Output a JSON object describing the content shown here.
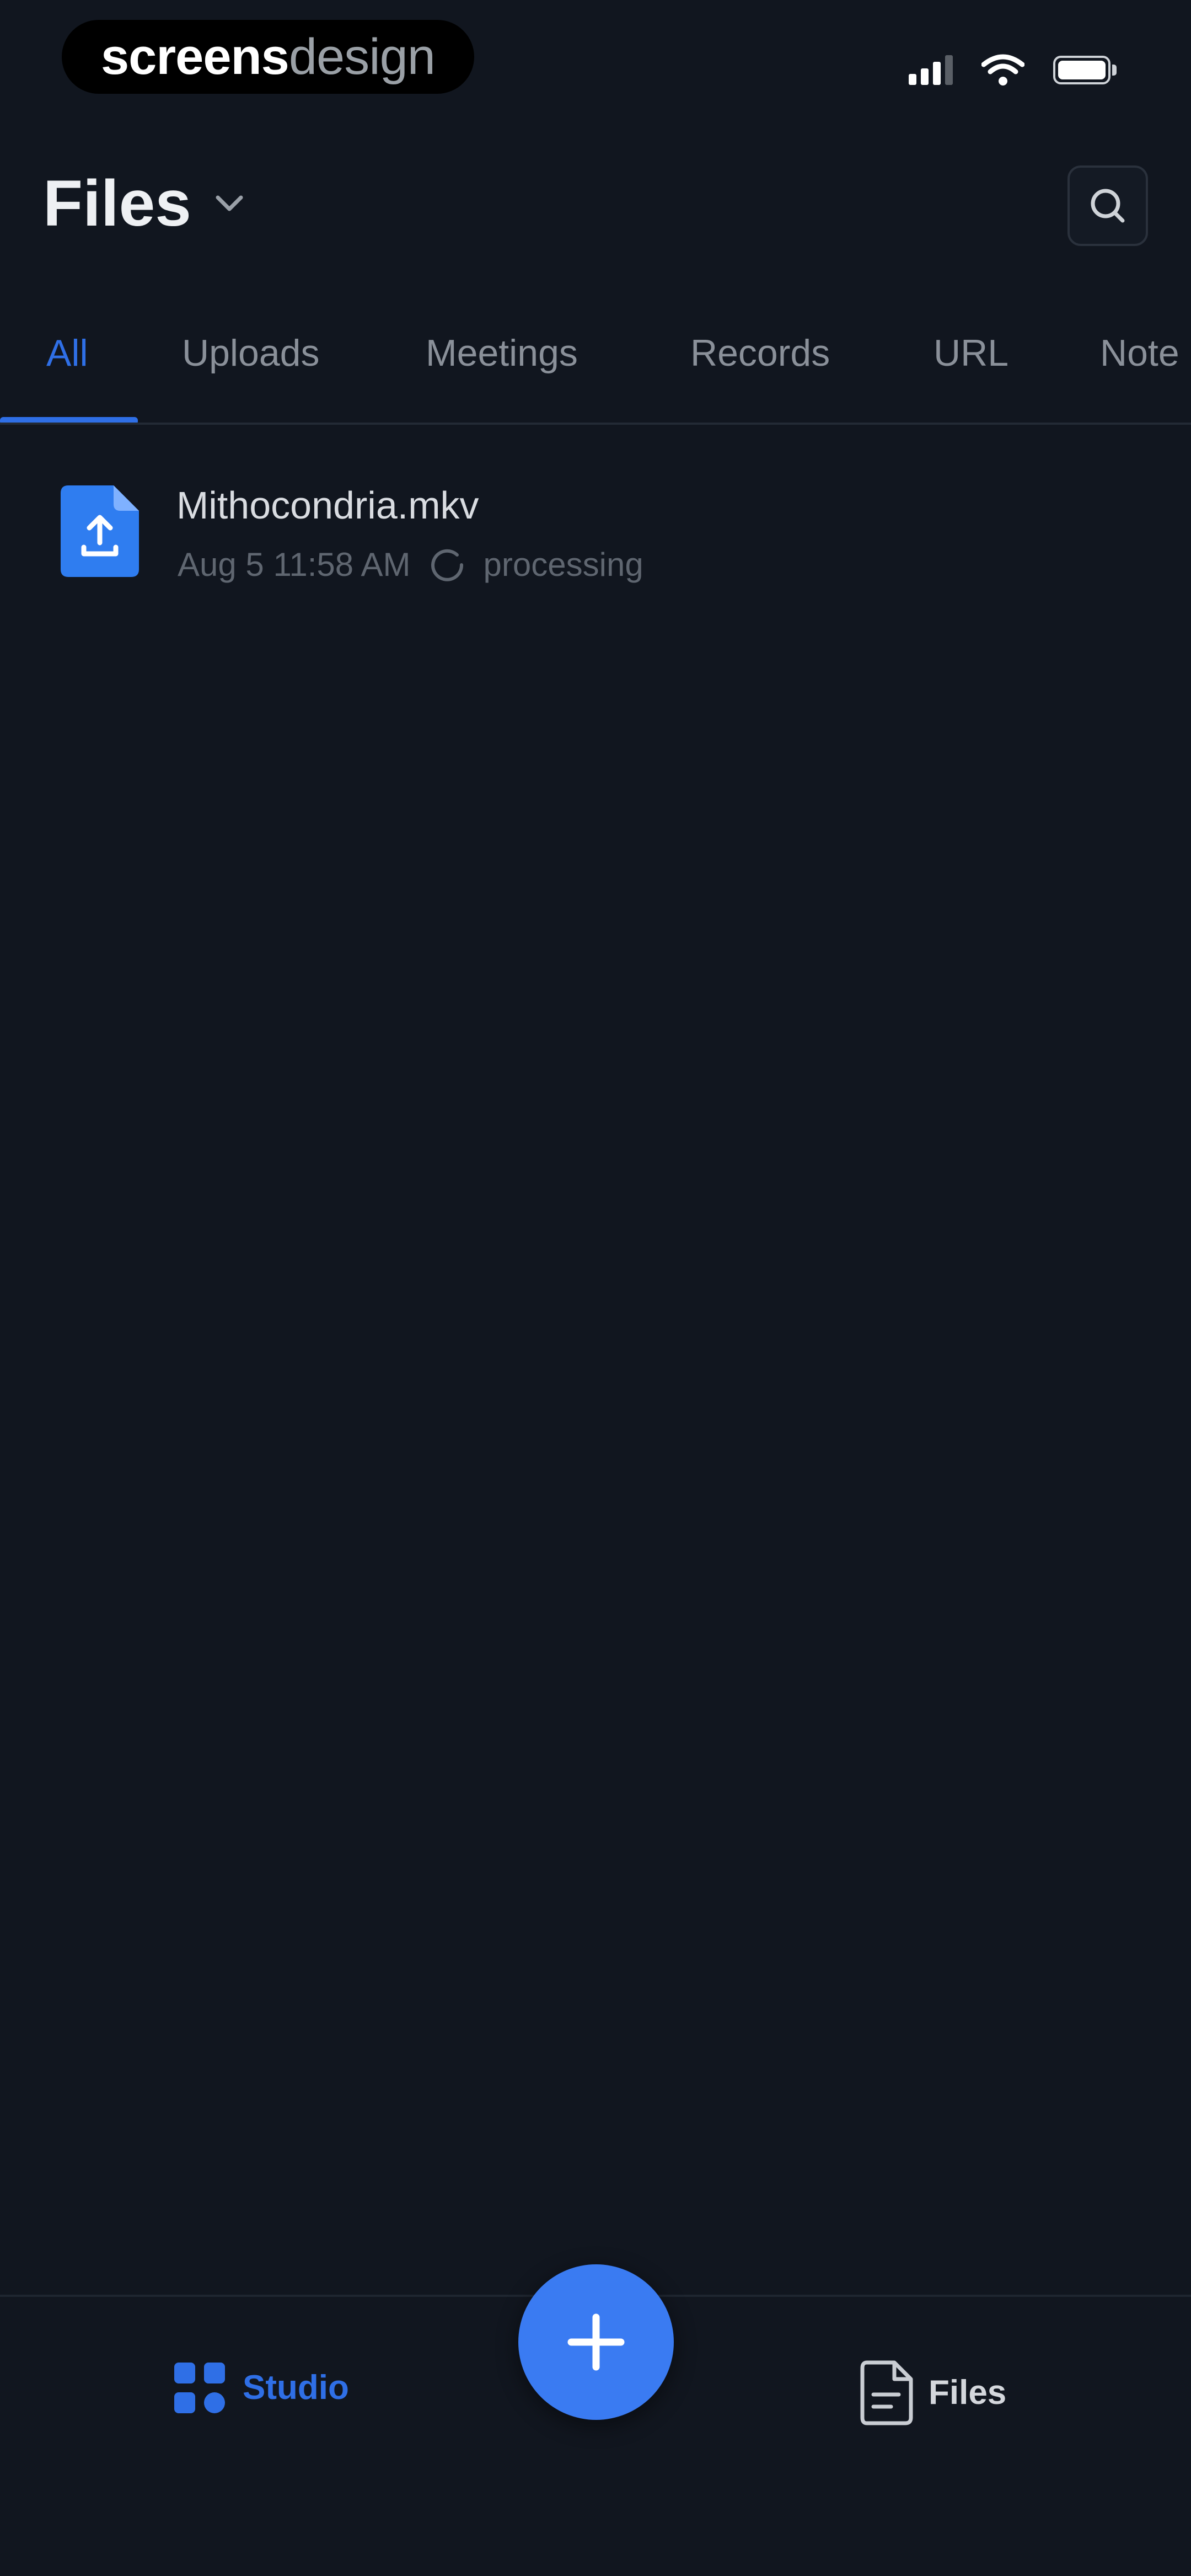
{
  "status_bar": {
    "brand_primary": "screens",
    "brand_secondary": "design",
    "signal_icon": "signal-bars-icon",
    "wifi_icon": "wifi-icon",
    "battery_icon": "battery-icon"
  },
  "header": {
    "title": "Files",
    "dropdown_icon": "chevron-down-icon",
    "search_icon": "search-icon"
  },
  "tabs": [
    {
      "label": "All",
      "active": true
    },
    {
      "label": "Uploads",
      "active": false
    },
    {
      "label": "Meetings",
      "active": false
    },
    {
      "label": "Records",
      "active": false
    },
    {
      "label": "URL",
      "active": false
    },
    {
      "label": "Note",
      "active": false
    }
  ],
  "files": [
    {
      "name": "Mithocondria.mkv",
      "timestamp": "Aug 5 11:58 AM",
      "status": "processing",
      "icon": "file-upload-icon",
      "status_icon": "loading-spinner-icon"
    }
  ],
  "bottom_nav": {
    "studio_label": "Studio",
    "files_label": "Files",
    "studio_icon": "grid-icon",
    "files_icon": "document-icon",
    "add_icon": "plus-icon"
  },
  "colors": {
    "background": "#11161f",
    "accent": "#2f6fe6",
    "fab": "#3a7bf2",
    "text_primary": "#eef0f3",
    "text_muted": "#8a9099"
  }
}
